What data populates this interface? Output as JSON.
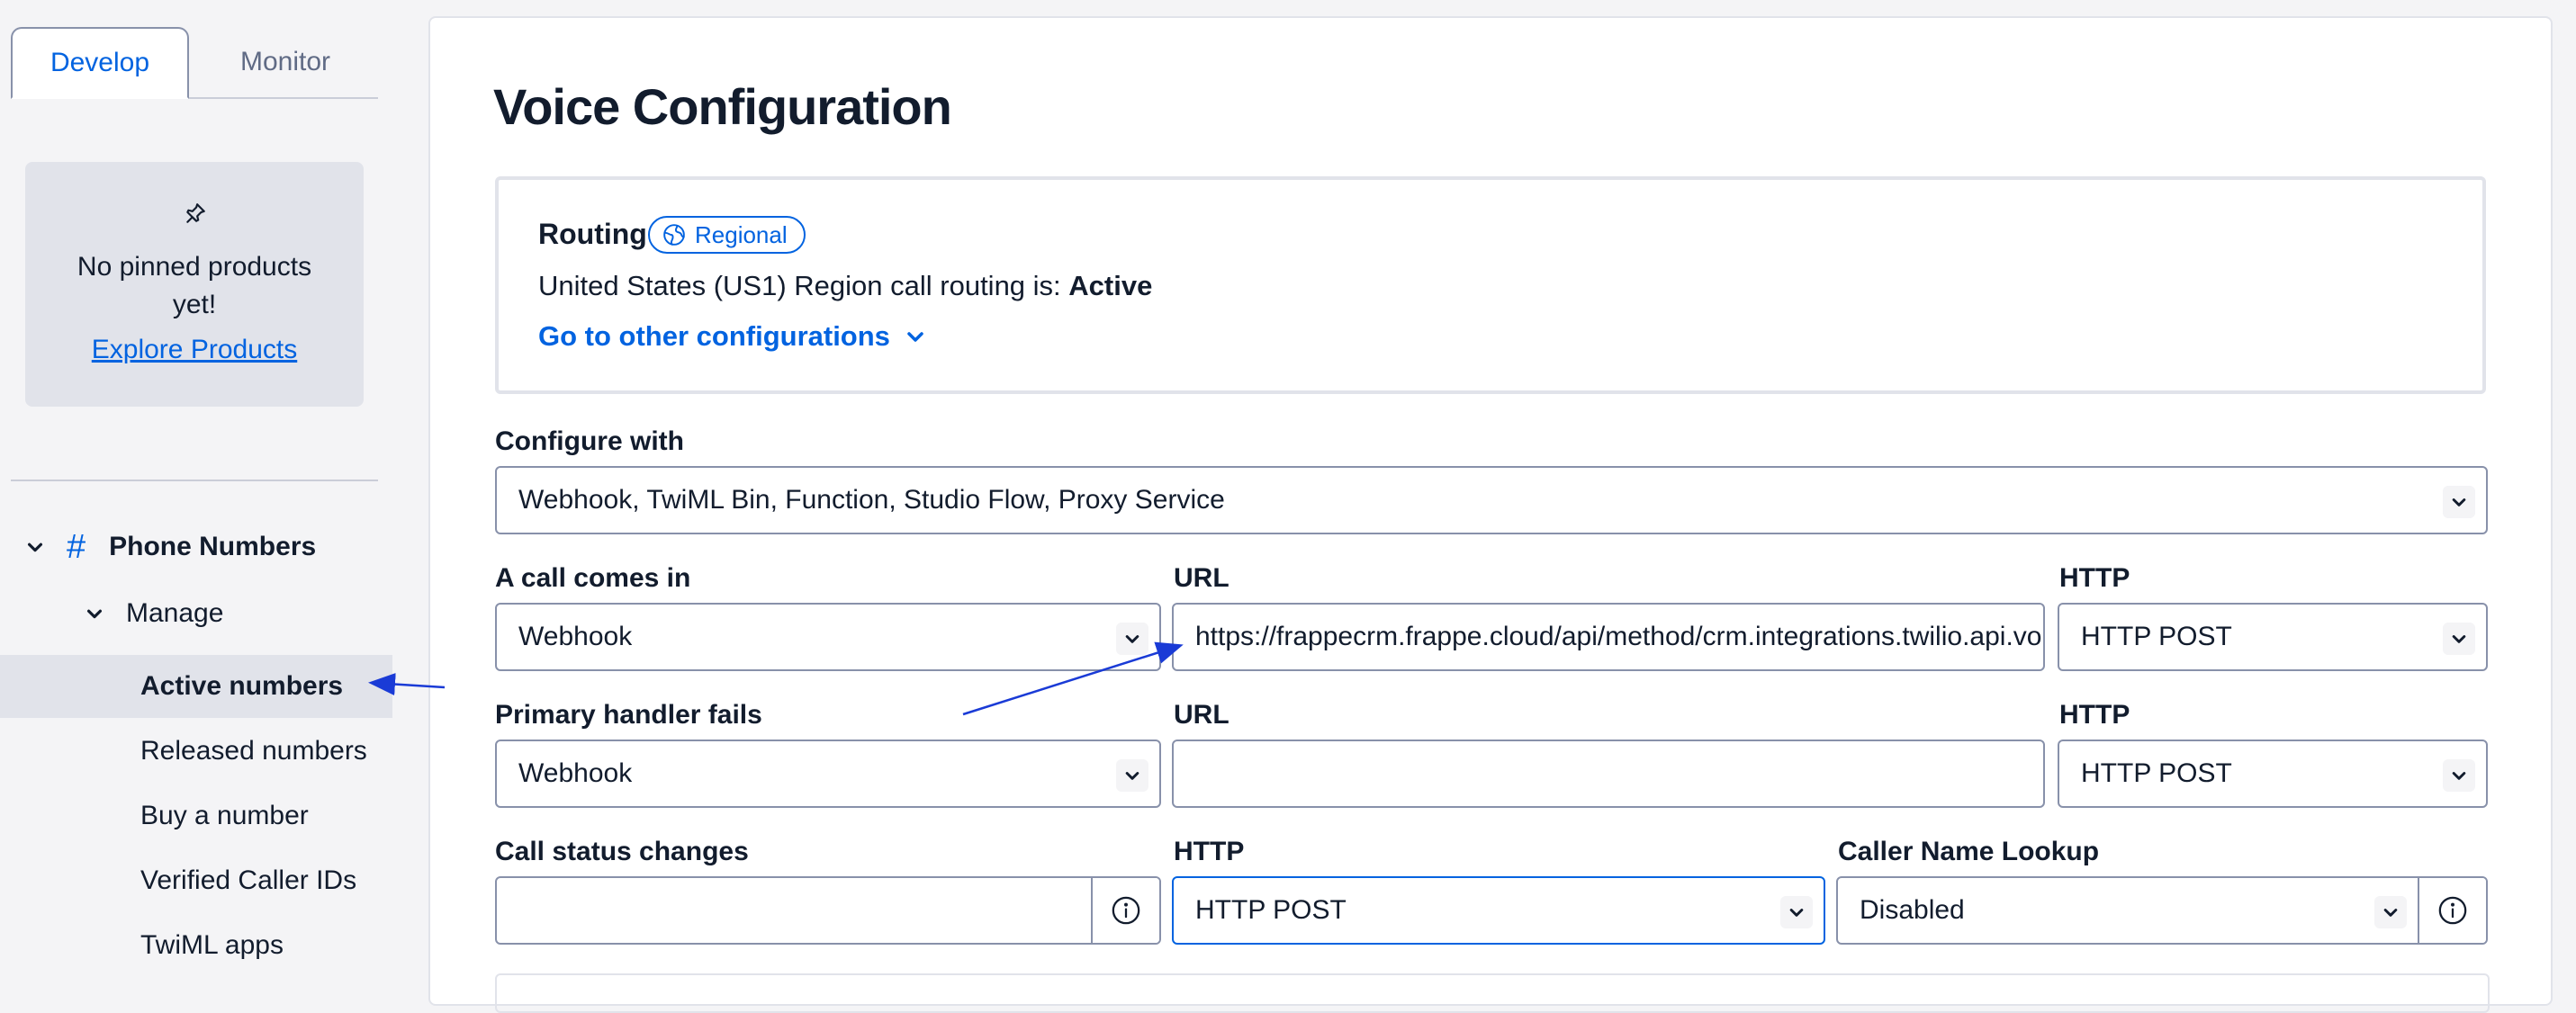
{
  "sidebar": {
    "tabs": [
      {
        "label": "Develop",
        "active": true
      },
      {
        "label": "Monitor",
        "active": false
      }
    ],
    "pinned": {
      "message": "No pinned products yet!",
      "explore_link": "Explore Products"
    },
    "section": {
      "hash": "#",
      "label": "Phone Numbers",
      "subsection": "Manage",
      "items": [
        {
          "label": "Active numbers",
          "active": true
        },
        {
          "label": "Released numbers",
          "active": false
        },
        {
          "label": "Buy a number",
          "active": false
        },
        {
          "label": "Verified Caller IDs",
          "active": false
        },
        {
          "label": "TwiML apps",
          "active": false
        }
      ]
    }
  },
  "main": {
    "title": "Voice Configuration",
    "routing": {
      "title": "Routing",
      "badge": "Regional",
      "status_prefix": "United States (US1) Region call routing is: ",
      "status_value": "Active",
      "other_configs": "Go to other configurations"
    },
    "configure_with": {
      "label": "Configure with",
      "value": "Webhook, TwiML Bin, Function, Studio Flow, Proxy Service"
    },
    "call_comes_in": {
      "label": "A call comes in",
      "type": "Webhook",
      "url_label": "URL",
      "url_value": "https://frappecrm.frappe.cloud/api/method/crm.integrations.twilio.api.voice",
      "http_label": "HTTP",
      "http_value": "HTTP POST"
    },
    "primary_fails": {
      "label": "Primary handler fails",
      "type": "Webhook",
      "url_label": "URL",
      "url_value": "",
      "http_label": "HTTP",
      "http_value": "HTTP POST"
    },
    "status_changes": {
      "label": "Call status changes",
      "value": "",
      "http_label": "HTTP",
      "http_value": "HTTP POST",
      "caller_label": "Caller Name Lookup",
      "caller_value": "Disabled"
    }
  },
  "icons": {
    "pin": "pin-icon",
    "globe": "globe-icon",
    "chevron": "chevron-down-icon",
    "info": "info-icon"
  },
  "colors": {
    "accent": "#0263e0",
    "sidebar_bg": "#f4f4f6",
    "active_item_bg": "#e1e3ea",
    "border": "#8891aa"
  }
}
